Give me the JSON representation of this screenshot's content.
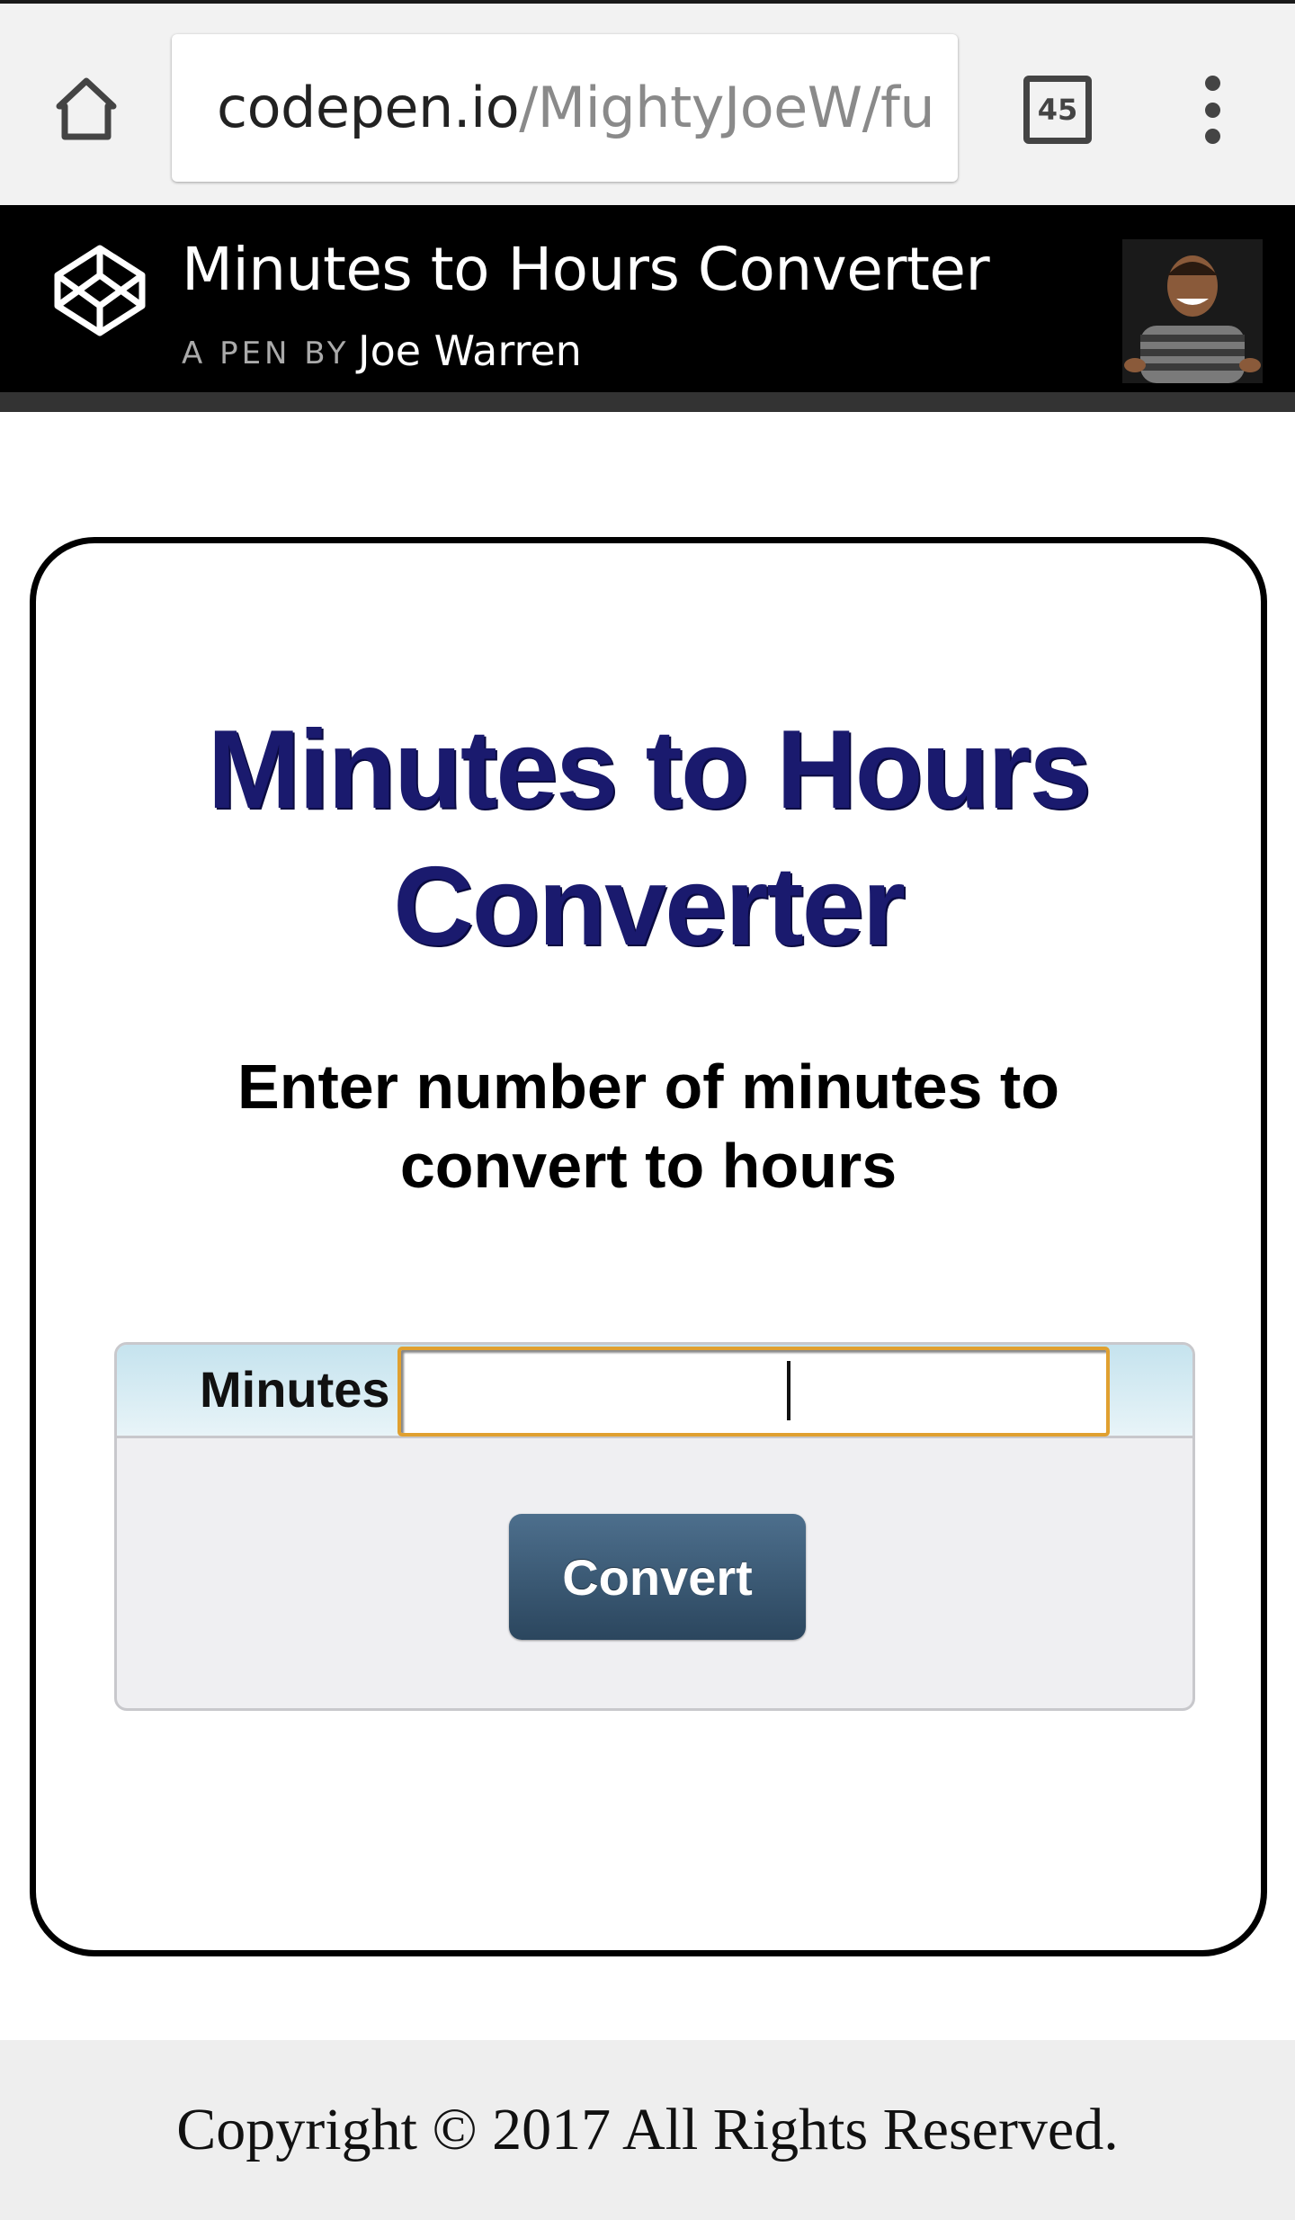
{
  "browser": {
    "url_host": "codepen.io",
    "url_path": "/MightyJoeW/fu",
    "tab_count": "45",
    "icons": {
      "home": "home-icon",
      "tabs": "tabs-icon",
      "menu": "more-vert-icon"
    }
  },
  "pen": {
    "title": "Minutes to Hours Converter",
    "by_label": "A PEN BY",
    "author": "Joe Warren",
    "logo": "codepen-logo-icon"
  },
  "main": {
    "title": "Minutes to Hours Converter",
    "subtitle_line1": "Enter number of minutes to",
    "subtitle_line2": "convert to hours",
    "form": {
      "minutes_label": "Minutes",
      "minutes_value": "",
      "convert_label": "Convert"
    }
  },
  "footer": {
    "copyright": "Copyright © 2017 All Rights Reserved."
  },
  "colors": {
    "title": "#1a1a6e",
    "button": "#3a5872",
    "input_border": "#e0a030",
    "form_row": "#c5e3ee"
  }
}
